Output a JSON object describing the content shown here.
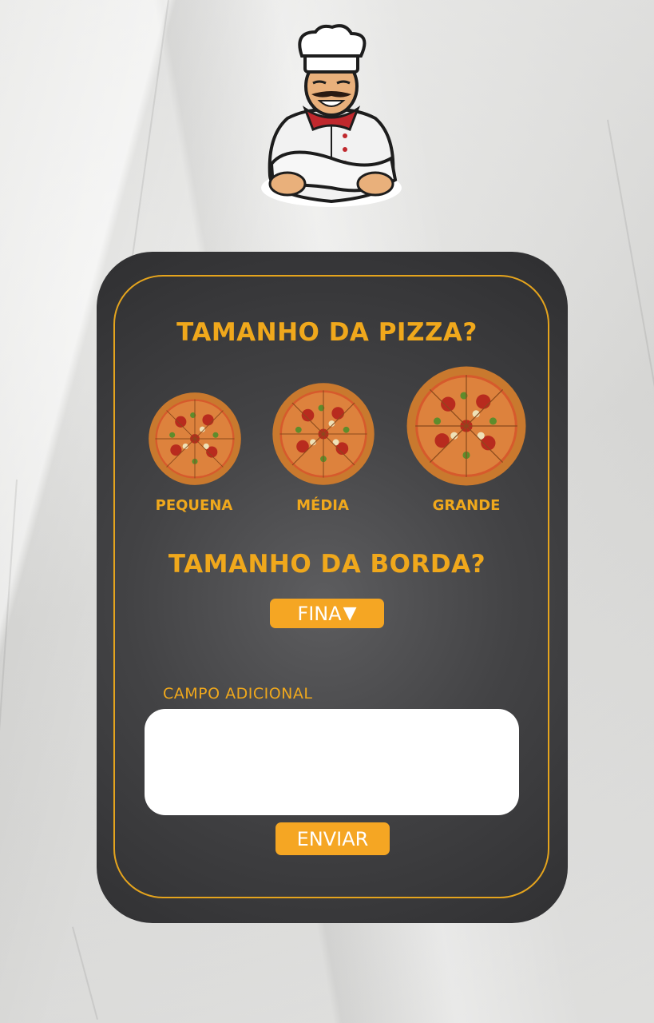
{
  "form": {
    "pizza_size_heading": "TAMANHO DA PIZZA?",
    "sizes": [
      {
        "label": "PEQUENA"
      },
      {
        "label": "MÉDIA"
      },
      {
        "label": "GRANDE"
      }
    ],
    "crust_heading": "TAMANHO DA BORDA?",
    "crust_select": {
      "value": "FINA",
      "caret": "▼"
    },
    "additional_field": {
      "label": "CAMPO ADICIONAL",
      "value": ""
    },
    "submit_label": "ENVIAR"
  },
  "colors": {
    "accent": "#f0a81c",
    "button": "#f5a623",
    "card": "#3a3a3c",
    "background": "#e4e4e2"
  },
  "icons": {
    "mascot": "chef-mascot-icon",
    "pizza": "pizza-icon",
    "caret": "caret-down-icon"
  }
}
